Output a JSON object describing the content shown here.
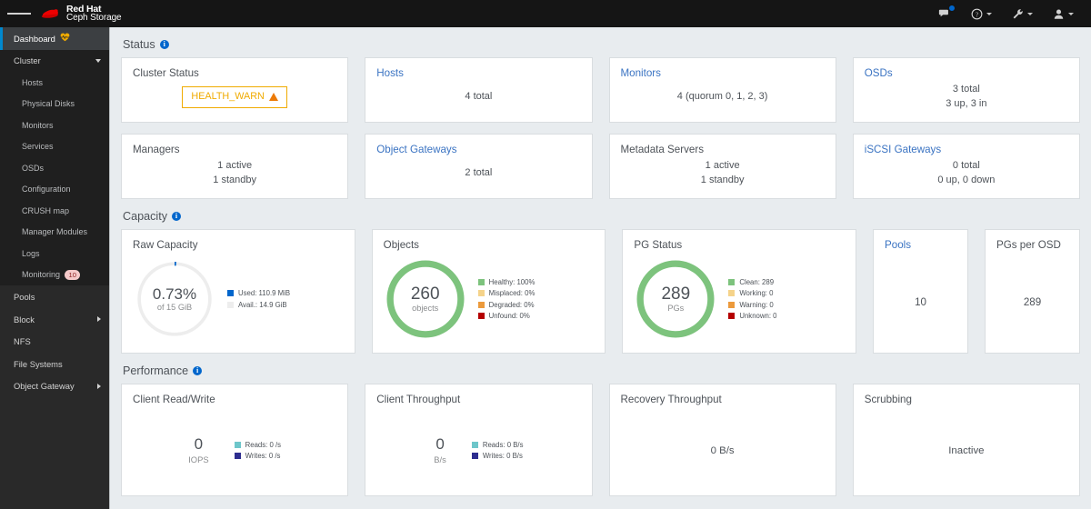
{
  "navbar": {
    "toggle_label": "menu-toggle",
    "brand_line1": "Red Hat",
    "brand_line2": "Ceph Storage",
    "items": [
      {
        "name": "notifications",
        "icon": "chat-bubble-icon",
        "badge": true
      },
      {
        "name": "help",
        "icon": "help-circle-icon",
        "caret": true
      },
      {
        "name": "tools",
        "icon": "wrench-icon",
        "caret": true
      },
      {
        "name": "user",
        "icon": "user-icon",
        "caret": true
      }
    ]
  },
  "sidebar": {
    "dashboard": {
      "label": "Dashboard",
      "icon": "heartbeat-icon"
    },
    "cluster": {
      "label": "Cluster"
    },
    "cluster_children": [
      {
        "label": "Hosts"
      },
      {
        "label": "Physical Disks"
      },
      {
        "label": "Monitors"
      },
      {
        "label": "Services"
      },
      {
        "label": "OSDs"
      },
      {
        "label": "Configuration"
      },
      {
        "label": "CRUSH map"
      },
      {
        "label": "Manager Modules"
      },
      {
        "label": "Logs"
      },
      {
        "label": "Monitoring",
        "badge": "10"
      }
    ],
    "bottom": [
      {
        "label": "Pools",
        "expandable": false
      },
      {
        "label": "Block",
        "expandable": true
      },
      {
        "label": "NFS",
        "expandable": false
      },
      {
        "label": "File Systems",
        "expandable": false
      },
      {
        "label": "Object Gateway",
        "expandable": true
      }
    ]
  },
  "sections": {
    "status": "Status",
    "capacity": "Capacity",
    "performance": "Performance"
  },
  "status_cards": [
    {
      "title": "Cluster Status",
      "link": false,
      "health": "HEALTH_WARN",
      "lines": []
    },
    {
      "title": "Hosts",
      "link": true,
      "lines": [
        "4 total"
      ]
    },
    {
      "title": "Monitors",
      "link": true,
      "lines": [
        "4 (quorum 0, 1, 2, 3)"
      ]
    },
    {
      "title": "OSDs",
      "link": true,
      "lines": [
        "3 total",
        "3 up, 3 in"
      ]
    },
    {
      "title": "Managers",
      "link": false,
      "lines": [
        "1 active",
        "1 standby"
      ]
    },
    {
      "title": "Object Gateways",
      "link": true,
      "lines": [
        "2 total"
      ]
    },
    {
      "title": "Metadata Servers",
      "link": false,
      "lines": [
        "1 active",
        "1 standby"
      ]
    },
    {
      "title": "iSCSI Gateways",
      "link": true,
      "lines": [
        "0 total",
        "0 up, 0 down"
      ]
    }
  ],
  "capacity": {
    "raw": {
      "title": "Raw Capacity",
      "center_main": "0.73%",
      "center_sub": "of 15 GiB",
      "legend": [
        {
          "label": "Used: 110.9 MiB",
          "color": "#0066cc"
        },
        {
          "label": "Avail.: 14.9 GiB",
          "color": "#ededed"
        }
      ]
    },
    "objects": {
      "title": "Objects",
      "center_main": "260",
      "center_sub": "objects",
      "legend": [
        {
          "label": "Healthy: 100%",
          "color": "#7dc37d"
        },
        {
          "label": "Misplaced: 0%",
          "color": "#f5d38a"
        },
        {
          "label": "Degraded: 0%",
          "color": "#ec9a3c"
        },
        {
          "label": "Unfound: 0%",
          "color": "#b40000"
        }
      ]
    },
    "pg_status": {
      "title": "PG Status",
      "center_main": "289",
      "center_sub": "PGs",
      "legend": [
        {
          "label": "Clean: 289",
          "color": "#7dc37d"
        },
        {
          "label": "Working: 0",
          "color": "#f5d38a"
        },
        {
          "label": "Warning: 0",
          "color": "#ec9a3c"
        },
        {
          "label": "Unknown: 0",
          "color": "#b40000"
        }
      ]
    },
    "pools": {
      "title": "Pools",
      "value": "10"
    },
    "pgs_per_osd": {
      "title": "PGs per OSD",
      "value": "289"
    }
  },
  "performance": {
    "client_rw": {
      "title": "Client Read/Write",
      "value": "0",
      "unit": "IOPS",
      "legend": [
        {
          "label": "Reads: 0 /s",
          "color": "#6ec6ca"
        },
        {
          "label": "Writes: 0 /s",
          "color": "#2d2d8f"
        }
      ]
    },
    "client_throughput": {
      "title": "Client Throughput",
      "value": "0",
      "unit": "B/s",
      "legend": [
        {
          "label": "Reads: 0 B/s",
          "color": "#6ec6ca"
        },
        {
          "label": "Writes: 0 B/s",
          "color": "#2d2d8f"
        }
      ]
    },
    "recovery_throughput": {
      "title": "Recovery Throughput",
      "value": "0 B/s"
    },
    "scrubbing": {
      "title": "Scrubbing",
      "value": "Inactive"
    }
  },
  "chart_data": [
    {
      "type": "pie",
      "title": "Raw Capacity",
      "labels": [
        "Used: 110.9 MiB",
        "Avail.: 14.9 GiB"
      ],
      "values": [
        0.73,
        99.27
      ],
      "colors": [
        "#0066cc",
        "#ededed"
      ],
      "center_label": "0.73%",
      "center_sublabel": "of 15 GiB",
      "legend_position": "right"
    },
    {
      "type": "pie",
      "title": "Objects",
      "labels": [
        "Healthy: 100%",
        "Misplaced: 0%",
        "Degraded: 0%",
        "Unfound: 0%"
      ],
      "values": [
        100,
        0,
        0,
        0
      ],
      "colors": [
        "#7dc37d",
        "#f5d38a",
        "#ec9a3c",
        "#b40000"
      ],
      "center_label": "260",
      "center_sublabel": "objects",
      "legend_position": "right"
    },
    {
      "type": "pie",
      "title": "PG Status",
      "labels": [
        "Clean: 289",
        "Working: 0",
        "Warning: 0",
        "Unknown: 0"
      ],
      "values": [
        289,
        0,
        0,
        0
      ],
      "colors": [
        "#7dc37d",
        "#f5d38a",
        "#ec9a3c",
        "#b40000"
      ],
      "center_label": "289",
      "center_sublabel": "PGs",
      "legend_position": "right"
    }
  ]
}
